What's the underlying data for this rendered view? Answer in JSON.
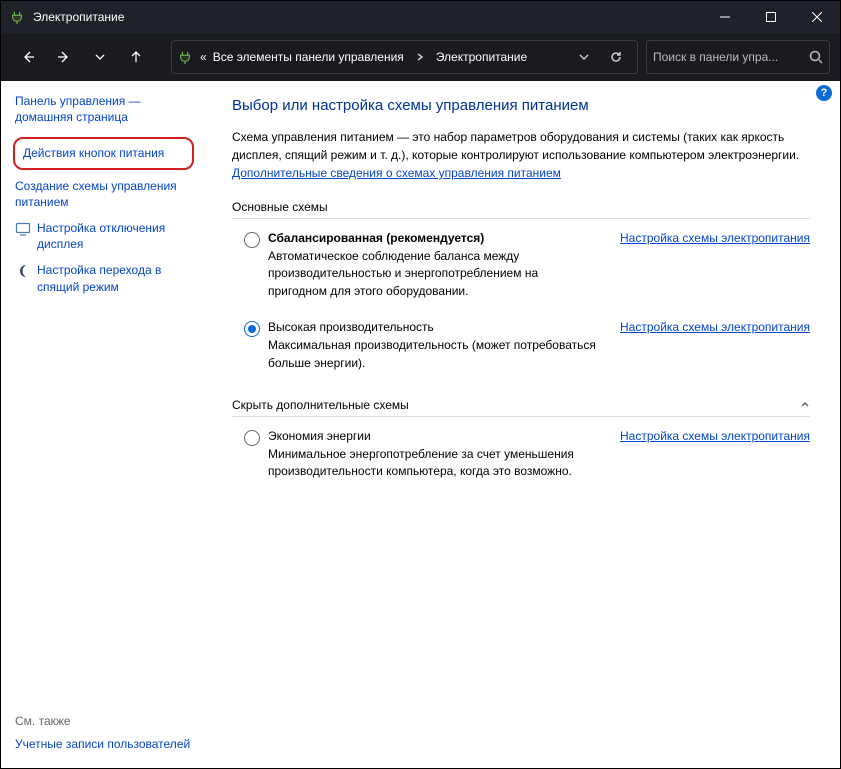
{
  "titlebar": {
    "title": "Электропитание"
  },
  "breadcrumb": {
    "prefix": "«",
    "seg1": "Все элементы панели управления",
    "seg2": "Электропитание"
  },
  "search": {
    "placeholder": "Поиск в панели упра..."
  },
  "sidebar": {
    "home_label": "Панель управления — домашняя страница",
    "power_buttons_label": "Действия кнопок питания",
    "create_plan_label": "Создание схемы управления питанием",
    "display_off_label": "Настройка отключения дисплея",
    "sleep_label": "Настройка перехода в спящий режим",
    "see_also_label": "См. также",
    "user_accounts_label": "Учетные записи пользователей"
  },
  "main": {
    "heading": "Выбор или настройка схемы управления питанием",
    "description_a": "Схема управления питанием — это набор параметров оборудования и системы (таких как яркость дисплея, спящий режим и т. д.), которые контролируют использование компьютером электроэнергии. ",
    "description_link": "Дополнительные сведения о схемах управления питанием",
    "group_basic_label": "Основные схемы",
    "group_hidden_label": "Скрыть дополнительные схемы",
    "change_settings_label": "Настройка схемы электропитания",
    "plans": {
      "balanced": {
        "name": "Сбалансированная (рекомендуется)",
        "desc": "Автоматическое соблюдение баланса между производительностью и энергопотреблением на пригодном для этого оборудовании."
      },
      "high_perf": {
        "name": "Высокая производительность",
        "desc": "Максимальная производительность (может потребоваться больше энергии)."
      },
      "power_saver": {
        "name": "Экономия энергии",
        "desc": "Минимальное энергопотребление за счет уменьшения производительности компьютера, когда это возможно."
      }
    }
  }
}
